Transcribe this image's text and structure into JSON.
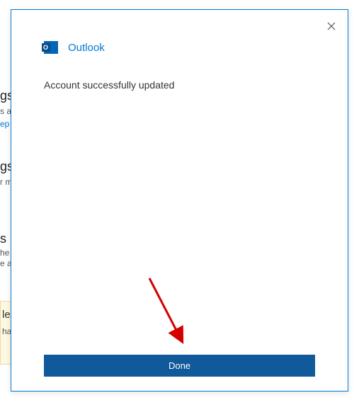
{
  "background": {
    "heading1_suffix": "gs",
    "desc1_suffix": "s ac",
    "link1_suffix": "ep t",
    "heading2_suffix": "gs",
    "desc2_suffix": "r m",
    "heading3_suffix": "s",
    "desc3a_suffix": "he",
    "desc3b_suffix": "e ac",
    "yellow_title_suffix": "le",
    "yellow_desc_suffix": "ha"
  },
  "dialog": {
    "app_name": "Outlook",
    "message": "Account successfully updated",
    "done_label": "Done"
  }
}
